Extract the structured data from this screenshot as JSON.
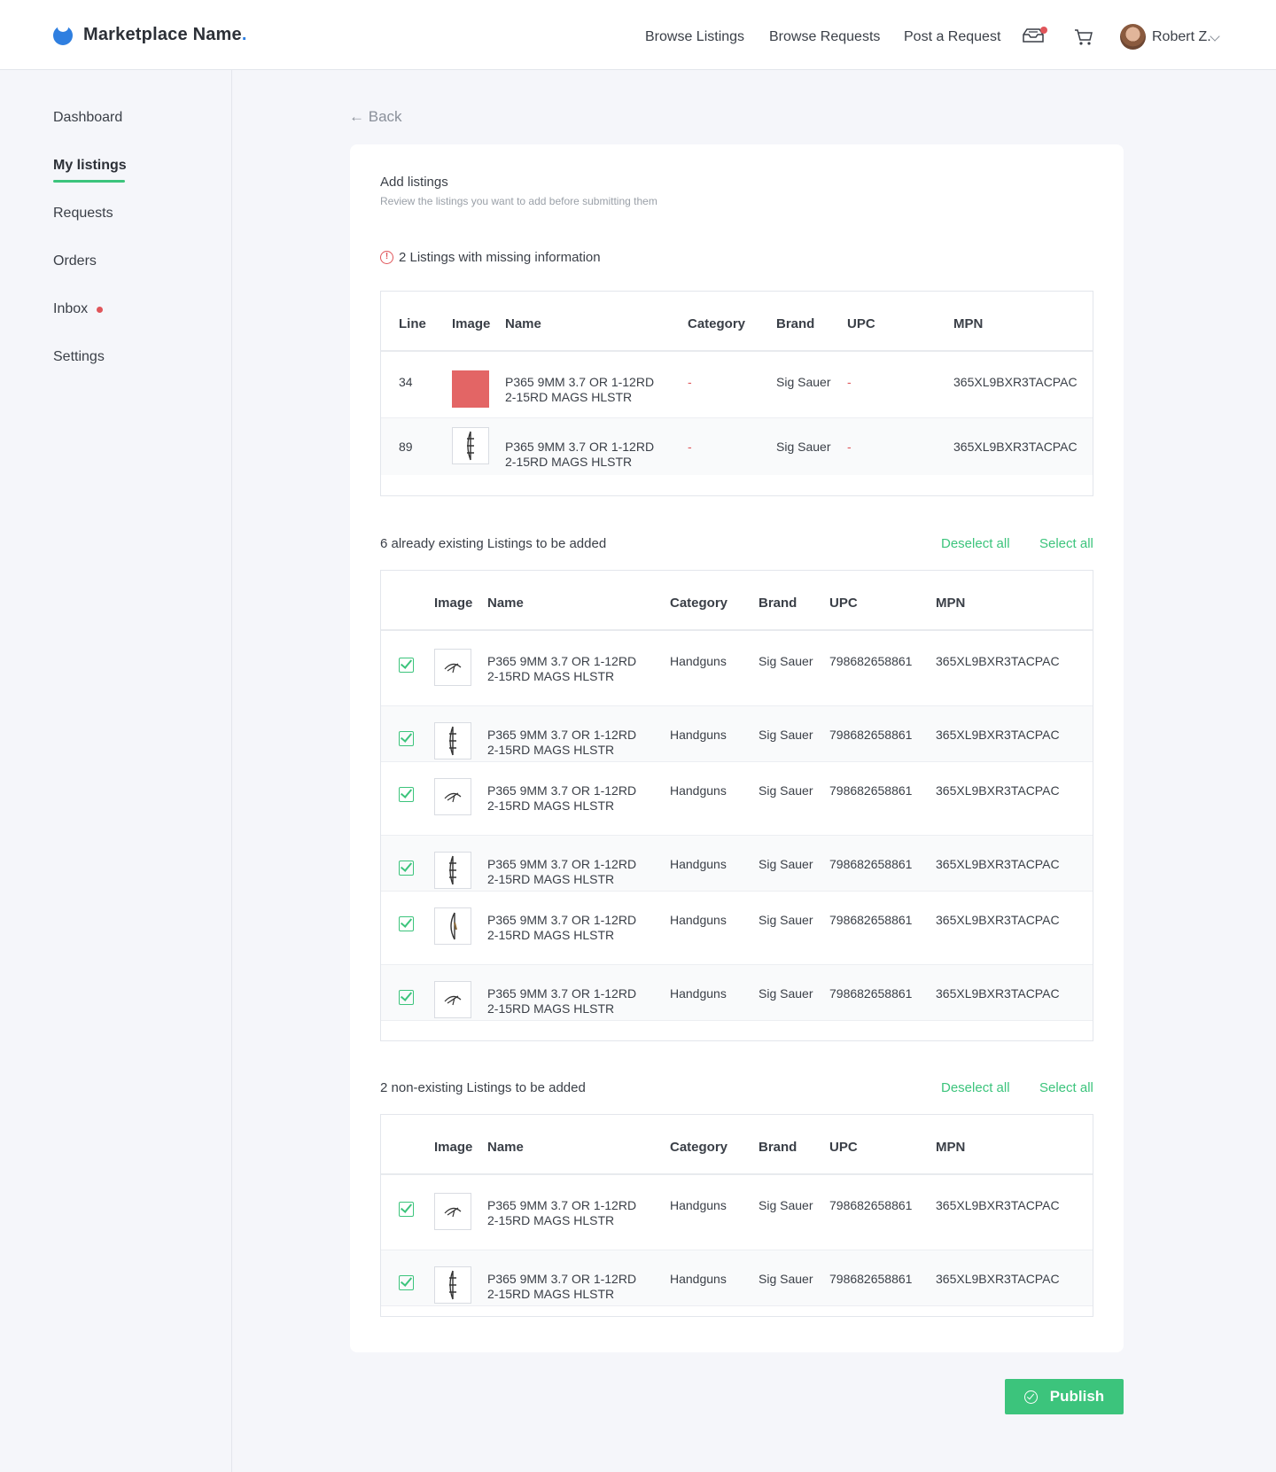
{
  "header": {
    "brand": "Marketplace Name",
    "brand_dot": ".",
    "nav": [
      "Browse Listings",
      "Browse Requests",
      "Post a Request"
    ],
    "user_name": "Robert Z.",
    "icons": [
      "inbox-tray-icon",
      "cart-icon",
      "chevron-down-icon"
    ],
    "accent_color": "#3cc47c",
    "brand_color": "#2f7fe0",
    "alert_color": "#e0555a"
  },
  "sidebar": {
    "items": [
      "Dashboard",
      "My listings",
      "Requests",
      "Orders",
      "Inbox",
      "Settings"
    ],
    "active": "My listings"
  },
  "back_label": "Back",
  "card": {
    "title": "Add listings",
    "subtitle": "Review the listings you want to add before submitting them",
    "warning": "2 Listings with missing information"
  },
  "missing_table": {
    "headers": [
      "Line",
      "Image",
      "Name",
      "Category",
      "Brand",
      "UPC",
      "MPN"
    ],
    "rows": [
      {
        "line": "34",
        "name1": "P365 9MM 3.7 OR 1-12RD",
        "name2": "2-15RD MAGS HLSTR",
        "category": "-",
        "brand": "Sig Sauer",
        "upc": "-",
        "mpn": "365XL9BXR3TACPAC"
      },
      {
        "line": "89",
        "name1": "P365 9MM 3.7 OR 1-12RD",
        "name2": "2-15RD MAGS HLSTR",
        "category": "-",
        "brand": "Sig Sauer",
        "upc": "-",
        "mpn": "365XL9BXR3TACPAC"
      }
    ]
  },
  "existing": {
    "label": "6 already existing Listings to be added",
    "deselect": "Deselect all",
    "select": "Select all",
    "headers": [
      "Image",
      "Name",
      "Category",
      "Brand",
      "UPC",
      "MPN"
    ],
    "rows": [
      {
        "name1": "P365 9MM 3.7 OR 1-12RD",
        "name2": "2-15RD MAGS HLSTR",
        "category": "Handguns",
        "brand": "Sig Sauer",
        "upc": "798682658861",
        "mpn": "365XL9BXR3TACPAC"
      },
      {
        "name1": "P365 9MM 3.7 OR 1-12RD",
        "name2": "2-15RD MAGS HLSTR",
        "category": "Handguns",
        "brand": "Sig Sauer",
        "upc": "798682658861",
        "mpn": "365XL9BXR3TACPAC"
      },
      {
        "name1": "P365 9MM 3.7 OR 1-12RD",
        "name2": "2-15RD MAGS HLSTR",
        "category": "Handguns",
        "brand": "Sig Sauer",
        "upc": "798682658861",
        "mpn": "365XL9BXR3TACPAC"
      },
      {
        "name1": "P365 9MM 3.7 OR 1-12RD",
        "name2": "2-15RD MAGS HLSTR",
        "category": "Handguns",
        "brand": "Sig Sauer",
        "upc": "798682658861",
        "mpn": "365XL9BXR3TACPAC"
      },
      {
        "name1": "P365 9MM 3.7 OR 1-12RD",
        "name2": "2-15RD MAGS HLSTR",
        "category": "Handguns",
        "brand": "Sig Sauer",
        "upc": "798682658861",
        "mpn": "365XL9BXR3TACPAC"
      },
      {
        "name1": "P365 9MM 3.7 OR 1-12RD",
        "name2": "2-15RD MAGS HLSTR",
        "category": "Handguns",
        "brand": "Sig Sauer",
        "upc": "798682658861",
        "mpn": "365XL9BXR3TACPAC"
      }
    ]
  },
  "nonexisting": {
    "label": "2 non-existing Listings to be added",
    "deselect": "Deselect all",
    "select": "Select all",
    "headers": [
      "Image",
      "Name",
      "Category",
      "Brand",
      "UPC",
      "MPN"
    ],
    "rows": [
      {
        "name1": "P365 9MM 3.7 OR 1-12RD",
        "name2": "2-15RD MAGS HLSTR",
        "category": "Handguns",
        "brand": "Sig Sauer",
        "upc": "798682658861",
        "mpn": "365XL9BXR3TACPAC"
      },
      {
        "name1": "P365 9MM 3.7 OR 1-12RD",
        "name2": "2-15RD MAGS HLSTR",
        "category": "Handguns",
        "brand": "Sig Sauer",
        "upc": "798682658861",
        "mpn": "365XL9BXR3TACPAC"
      }
    ]
  },
  "publish_label": "Publish"
}
